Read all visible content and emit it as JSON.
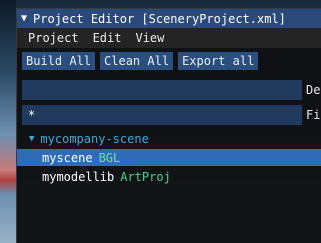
{
  "window": {
    "title": "Project Editor [SceneryProject.xml]",
    "collapse_arrow": "▼"
  },
  "menu": {
    "items": [
      "Project",
      "Edit",
      "View"
    ]
  },
  "toolbar": {
    "build_all": "Build All",
    "clean_all": "Clean All",
    "export_all": "Export all"
  },
  "fields": {
    "description_value": "",
    "description_label": "De",
    "filter_value": "*",
    "filter_label": "Fi"
  },
  "tree": {
    "group": {
      "label": "mycompany-scene",
      "toggle": "▼"
    },
    "items": [
      {
        "name": "myscene",
        "type": "BGL",
        "selected": true
      },
      {
        "name": "mymodellib",
        "type": "ArtProj",
        "selected": false
      }
    ]
  },
  "colors": {
    "title_bar": "#294a7a",
    "button": "#2a4f7e",
    "selection": "#2f6bb8",
    "group_text": "#41a6d8",
    "type_text": "#4ad08a"
  }
}
